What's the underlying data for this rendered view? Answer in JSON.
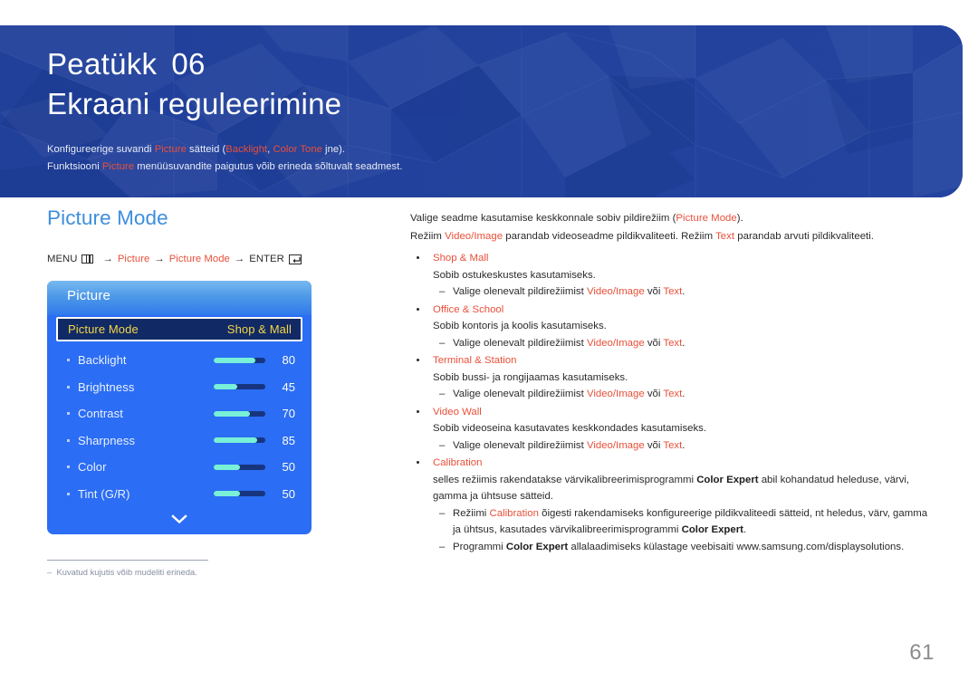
{
  "banner": {
    "chapter_label": "Peatükk",
    "chapter_number": "06",
    "title": "Ekraani reguleerimine",
    "desc_line1_a": "Konfigureerige suvandi ",
    "desc_line1_hl1": "Picture",
    "desc_line1_b": " sätteid (",
    "desc_line1_hl2": "Backlight",
    "desc_line1_c": ", ",
    "desc_line1_hl3": "Color Tone",
    "desc_line1_d": " jne).",
    "desc_line2_a": "Funktsiooni ",
    "desc_line2_hl1": "Picture",
    "desc_line2_b": " menüüsuvandite paigutus võib erineda sõltuvalt seadmest."
  },
  "left": {
    "section_title": "Picture Mode",
    "menu_path": {
      "menu_label": "MENU",
      "menu_icon": "menu-bars-icon",
      "arrow": "→",
      "step1": "Picture",
      "step2": "Picture Mode",
      "enter_label": "ENTER",
      "enter_icon": "enter-return-icon"
    },
    "osd": {
      "header_title": "Picture",
      "selected_row": {
        "label": "Picture Mode",
        "value": "Shop & Mall"
      },
      "rows": [
        {
          "label": "Backlight",
          "value": "80",
          "fill_pct": 80
        },
        {
          "label": "Brightness",
          "value": "45",
          "fill_pct": 45
        },
        {
          "label": "Contrast",
          "value": "70",
          "fill_pct": 70
        },
        {
          "label": "Sharpness",
          "value": "85",
          "fill_pct": 85
        },
        {
          "label": "Color",
          "value": "50",
          "fill_pct": 50
        },
        {
          "label": "Tint (G/R)",
          "value": "50",
          "fill_pct": 50
        }
      ],
      "more_icon": "chevron-down-icon"
    },
    "footnote": "Kuvatud kujutis võib mudeliti erineda.",
    "footnote_dash": "–"
  },
  "right": {
    "intro1_a": "Valige seadme kasutamise keskkonnale sobiv pildirežiim (",
    "intro1_hl": "Picture Mode",
    "intro1_b": ").",
    "intro2_a": "Režiim ",
    "intro2_hl1": "Video/Image",
    "intro2_b": " parandab videoseadme pildikvaliteeti. Režiim ",
    "intro2_hl2": "Text",
    "intro2_c": " parandab arvuti pildikvaliteeti.",
    "items": [
      {
        "title": "Shop & Mall",
        "body": "Sobib ostukeskustes kasutamiseks.",
        "sub_a": "Valige olenevalt pildirežiimist ",
        "sub_hl1": "Video/Image",
        "sub_b": " või ",
        "sub_hl2": "Text",
        "sub_c": "."
      },
      {
        "title": "Office & School",
        "body": "Sobib kontoris ja koolis kasutamiseks.",
        "sub_a": "Valige olenevalt pildirežiimist ",
        "sub_hl1": "Video/Image",
        "sub_b": " või ",
        "sub_hl2": "Text",
        "sub_c": "."
      },
      {
        "title": "Terminal & Station",
        "body": "Sobib bussi- ja rongijaamas kasutamiseks.",
        "sub_a": "Valige olenevalt pildirežiimist ",
        "sub_hl1": "Video/Image",
        "sub_b": " või ",
        "sub_hl2": "Text",
        "sub_c": "."
      },
      {
        "title": "Video Wall",
        "body": "Sobib videoseina kasutavates keskkondades kasutamiseks.",
        "sub_a": "Valige olenevalt pildirežiimist ",
        "sub_hl1": "Video/Image",
        "sub_b": " või ",
        "sub_hl2": "Text",
        "sub_c": "."
      }
    ],
    "calibration": {
      "title": "Calibration",
      "body_a": "selles režiimis rakendatakse värvikalibreerimisprogrammi ",
      "body_bold": "Color Expert",
      "body_b": " abil kohandatud heleduse, värvi, gamma ja ühtsuse sätteid.",
      "sub1_a": "Režiimi ",
      "sub1_hl": "Calibration",
      "sub1_b": " õigesti rakendamiseks konfigureerige pildikvaliteedi sätteid, nt heledus, värv, gamma ja ühtsus, kasutades värvikalibreerimisprogrammi ",
      "sub1_bold": "Color Expert",
      "sub1_c": ".",
      "sub2_a": "Programmi ",
      "sub2_bold": "Color Expert",
      "sub2_b": " allalaadimiseks külastage veebisaiti www.samsung.com/displaysolutions."
    }
  },
  "page_number": "61",
  "colors": {
    "banner_blue": "#21409a",
    "accent_red": "#e8503a",
    "section_blue": "#3e8ede",
    "osd_blue": "#2b6df4",
    "osd_selected_navy": "#112a66",
    "osd_selected_text": "#f5d547",
    "slider_fill": "#79f0d8",
    "slider_track": "#17357f"
  }
}
